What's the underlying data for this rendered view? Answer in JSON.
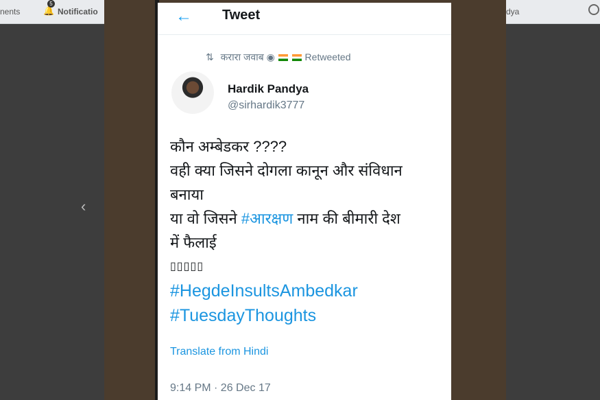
{
  "topbar": {
    "left_text": "nents",
    "notifications_label": "Notificatio",
    "notifications_count": "5",
    "right_text": "dya"
  },
  "tweet_header": {
    "title": "Tweet"
  },
  "retweet": {
    "retweeter": "करारा जवाब",
    "label": "Retweeted"
  },
  "author": {
    "name": "Hardik Pandya",
    "handle": "@sirhardik3777"
  },
  "tweet": {
    "line1": "कौन अम्बेडकर ????",
    "line2": "वही क्या जिसने दोगला कानून और संविधान",
    "line3": "बनाया",
    "line4_prefix": "या वो जिसने ",
    "line4_hashtag": "#आरक्षण",
    "line4_suffix": " नाम की बीमारी देश",
    "line5": "में फैलाई",
    "emoji_row": "▯▯▯▯▯",
    "hashtag1": "#HegdeInsultsAmbedkar",
    "hashtag2": "#TuesdayThoughts"
  },
  "translate_label": "Translate from Hindi",
  "timestamp": "9:14 PM · 26 Dec 17",
  "colors": {
    "twitter_blue": "#1b95e0",
    "backdrop": "#4b3c2d"
  }
}
